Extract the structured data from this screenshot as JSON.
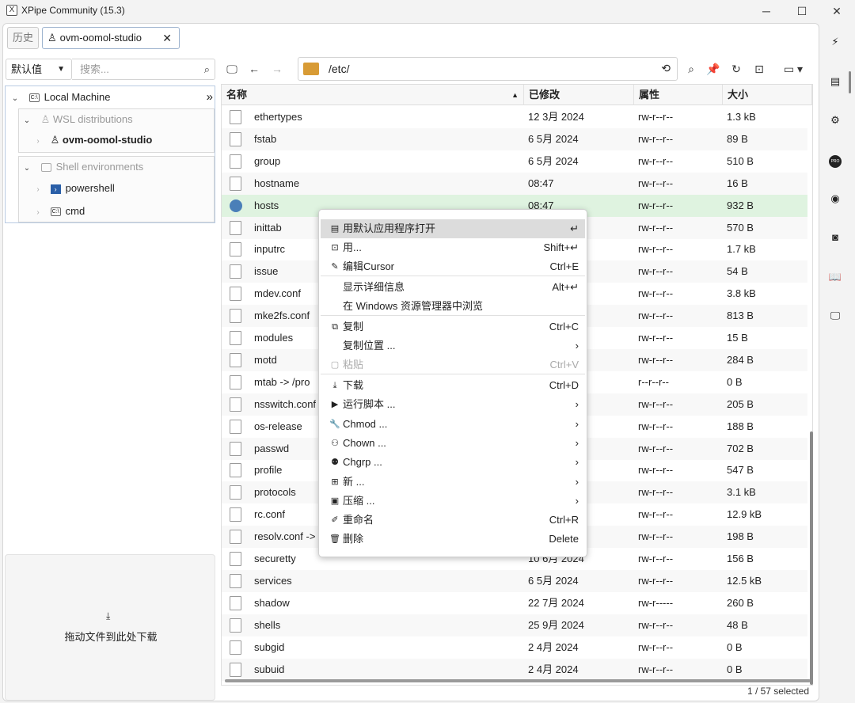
{
  "window": {
    "title": "XPipe Community (15.3)",
    "min": "─",
    "max": "☐",
    "close": "✕"
  },
  "tabs": {
    "history": "历史",
    "active": "ovm-oomol-studio",
    "close": "✕"
  },
  "sidebar": {
    "filter": "默认值",
    "search_placeholder": "搜索...",
    "local_machine": "Local Machine",
    "expand_glyph": "»",
    "wsl_group": "WSL distributions",
    "wsl_item": "ovm-oomol-studio",
    "shell_group": "Shell environments",
    "powershell": "powershell",
    "cmd": "cmd",
    "download_hint": "拖动文件到此处下载"
  },
  "toolbar": {
    "path": "/etc/"
  },
  "table": {
    "headers": {
      "name": "名称",
      "modified": "已修改",
      "attrs": "属性",
      "size": "大小"
    },
    "rows": [
      {
        "name": "ethertypes",
        "modified": "12 3月 2024",
        "attrs": "rw-r--r--",
        "size": "1.3 kB"
      },
      {
        "name": "fstab",
        "modified": "6 5月 2024",
        "attrs": "rw-r--r--",
        "size": "89 B"
      },
      {
        "name": "group",
        "modified": "6 5月 2024",
        "attrs": "rw-r--r--",
        "size": "510 B"
      },
      {
        "name": "hostname",
        "modified": "08:47",
        "attrs": "rw-r--r--",
        "size": "16 B"
      },
      {
        "name": "hosts",
        "modified": "08:47",
        "attrs": "rw-r--r--",
        "size": "932 B"
      },
      {
        "name": "inittab",
        "modified": "",
        "attrs": "rw-r--r--",
        "size": "570 B"
      },
      {
        "name": "inputrc",
        "modified": "",
        "attrs": "rw-r--r--",
        "size": "1.7 kB"
      },
      {
        "name": "issue",
        "modified": "",
        "attrs": "rw-r--r--",
        "size": "54 B"
      },
      {
        "name": "mdev.conf",
        "modified": "",
        "attrs": "rw-r--r--",
        "size": "3.8 kB"
      },
      {
        "name": "mke2fs.conf",
        "modified": "",
        "attrs": "rw-r--r--",
        "size": "813 B"
      },
      {
        "name": "modules",
        "modified": "",
        "attrs": "rw-r--r--",
        "size": "15 B"
      },
      {
        "name": "motd",
        "modified": "",
        "attrs": "rw-r--r--",
        "size": "284 B"
      },
      {
        "name": "mtab -> /pro",
        "modified": "",
        "attrs": "r--r--r--",
        "size": "0 B"
      },
      {
        "name": "nsswitch.conf",
        "modified": "",
        "attrs": "rw-r--r--",
        "size": "205 B"
      },
      {
        "name": "os-release",
        "modified": "",
        "attrs": "rw-r--r--",
        "size": "188 B"
      },
      {
        "name": "passwd",
        "modified": "",
        "attrs": "rw-r--r--",
        "size": "702 B"
      },
      {
        "name": "profile",
        "modified": "",
        "attrs": "rw-r--r--",
        "size": "547 B"
      },
      {
        "name": "protocols",
        "modified": "",
        "attrs": "rw-r--r--",
        "size": "3.1 kB"
      },
      {
        "name": "rc.conf",
        "modified": "",
        "attrs": "rw-r--r--",
        "size": "12.9 kB"
      },
      {
        "name": "resolv.conf ->",
        "modified": "",
        "attrs": "rw-r--r--",
        "size": "198 B"
      },
      {
        "name": "securetty",
        "modified": "10 6月 2024",
        "attrs": "rw-r--r--",
        "size": "156 B"
      },
      {
        "name": "services",
        "modified": "6 5月 2024",
        "attrs": "rw-r--r--",
        "size": "12.5 kB"
      },
      {
        "name": "shadow",
        "modified": "22 7月 2024",
        "attrs": "rw-r-----",
        "size": "260 B"
      },
      {
        "name": "shells",
        "modified": "25 9月 2024",
        "attrs": "rw-r--r--",
        "size": "48 B"
      },
      {
        "name": "subgid",
        "modified": "2 4月 2024",
        "attrs": "rw-r--r--",
        "size": "0 B"
      },
      {
        "name": "subuid",
        "modified": "2 4月 2024",
        "attrs": "rw-r--r--",
        "size": "0 B"
      }
    ],
    "status": "1 / 57 selected"
  },
  "context_menu": [
    {
      "label": "用默认应用程序打开",
      "shortcut": "↵",
      "icon": "▤"
    },
    {
      "label": "用...",
      "shortcut": "Shift+↵",
      "icon": "⊡"
    },
    {
      "label": "编辑Cursor",
      "shortcut": "Ctrl+E",
      "icon": "✎"
    },
    {
      "label": "显示详细信息",
      "shortcut": "Alt+↵",
      "icon": ""
    },
    {
      "label": "在 Windows 资源管理器中浏览",
      "shortcut": "",
      "icon": ""
    },
    {
      "label": "复制",
      "shortcut": "Ctrl+C",
      "icon": "⧉"
    },
    {
      "label": "复制位置 ...",
      "shortcut": "›",
      "icon": ""
    },
    {
      "label": "粘贴",
      "shortcut": "Ctrl+V",
      "icon": "▢"
    },
    {
      "label": "下载",
      "shortcut": "Ctrl+D",
      "icon": "⤓"
    },
    {
      "label": "运行脚本 ...",
      "shortcut": "›",
      "icon": "▶"
    },
    {
      "label": "Chmod ...",
      "shortcut": "›",
      "icon": "🔧"
    },
    {
      "label": "Chown ...",
      "shortcut": "›",
      "icon": "⚇"
    },
    {
      "label": "Chgrp ...",
      "shortcut": "›",
      "icon": "⚉"
    },
    {
      "label": "新 ...",
      "shortcut": "›",
      "icon": "⊞"
    },
    {
      "label": "压缩 ...",
      "shortcut": "›",
      "icon": "▣"
    },
    {
      "label": "重命名",
      "shortcut": "Ctrl+R",
      "icon": "✐"
    },
    {
      "label": "删除",
      "shortcut": "Delete",
      "icon": "🗑"
    }
  ],
  "rail_icons": [
    "plug-icon",
    "server-icon",
    "gears-icon",
    "pro-icon",
    "github-icon",
    "discord-icon",
    "book-icon",
    "monitor-icon"
  ]
}
